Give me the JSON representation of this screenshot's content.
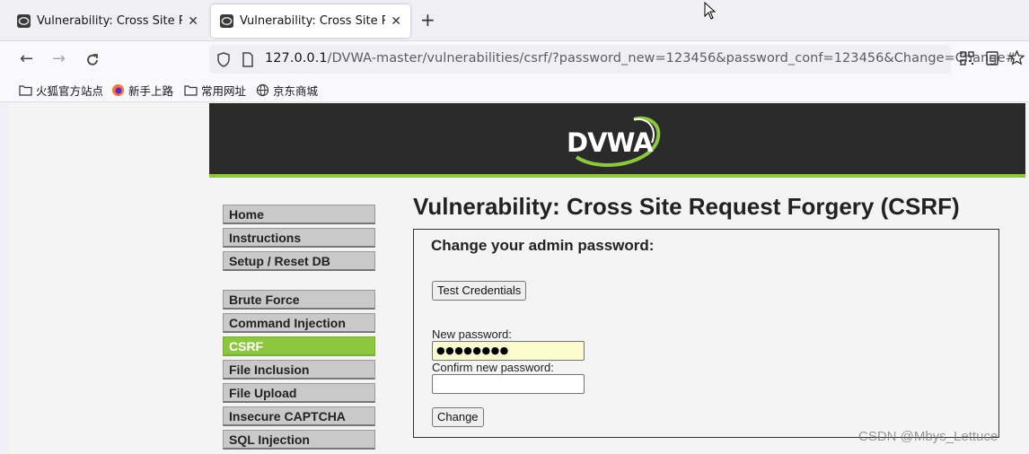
{
  "browser": {
    "tabs": [
      {
        "label": "Vulnerability: Cross Site Requ",
        "active": false
      },
      {
        "label": "Vulnerability: Cross Site Requ",
        "active": true
      }
    ],
    "url_host": "127.0.0.1",
    "url_path": "/DVWA-master/vulnerabilities/csrf/?password_new=123456&password_conf=123456&Change=Change#",
    "bookmarks": [
      "火狐官方站点",
      "新手上路",
      "常用网址",
      "京东商城"
    ]
  },
  "app": {
    "logo": "DVWA",
    "accent_color": "#8dc63f",
    "menu": [
      {
        "label": "Home"
      },
      {
        "label": "Instructions"
      },
      {
        "label": "Setup / Reset DB"
      },
      {
        "label": "Brute Force"
      },
      {
        "label": "Command Injection"
      },
      {
        "label": "CSRF",
        "selected": true
      },
      {
        "label": "File Inclusion"
      },
      {
        "label": "File Upload"
      },
      {
        "label": "Insecure CAPTCHA"
      },
      {
        "label": "SQL Injection"
      }
    ],
    "page_title": "Vulnerability: Cross Site Request Forgery (CSRF)",
    "form": {
      "heading": "Change your admin password:",
      "test_button": "Test Credentials",
      "new_password_label": "New password:",
      "new_password_value": "●●●●●●●●",
      "confirm_password_label": "Confirm new password:",
      "confirm_password_value": "",
      "submit_button": "Change"
    }
  },
  "watermark": "CSDN @Mbys_Lettuce"
}
